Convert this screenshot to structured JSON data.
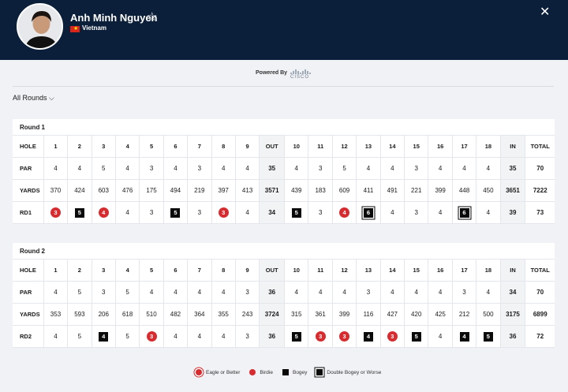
{
  "header": {
    "player_name": "Anh Minh Nguyen",
    "country": "Vietnam",
    "favorite_icon": "star-outline-icon",
    "close_icon": "close-icon",
    "colors": {
      "background": "#0b1f3a",
      "flag": "#da251d",
      "flag_star": "#ffde00"
    }
  },
  "sponsor": {
    "label": "Powered By",
    "brand": "CISCO"
  },
  "rounds_dropdown": {
    "label": "All Rounds"
  },
  "score_colors": {
    "under_par": "#d62b2f",
    "over_par": "#0a0a0a"
  },
  "rounds": [
    {
      "title": "Round 1",
      "head": [
        "HOLE",
        "1",
        "2",
        "3",
        "4",
        "5",
        "6",
        "7",
        "8",
        "9",
        "OUT",
        "10",
        "11",
        "12",
        "13",
        "14",
        "15",
        "16",
        "17",
        "18",
        "IN",
        "TOTAL"
      ],
      "par": [
        "PAR",
        "4",
        "4",
        "5",
        "4",
        "3",
        "4",
        "3",
        "4",
        "4",
        "35",
        "4",
        "3",
        "5",
        "4",
        "4",
        "3",
        "4",
        "4",
        "4",
        "35",
        "70"
      ],
      "yards": [
        "YARDS",
        "370",
        "424",
        "603",
        "476",
        "175",
        "494",
        "219",
        "397",
        "413",
        "3571",
        "439",
        "183",
        "609",
        "411",
        "491",
        "221",
        "399",
        "448",
        "450",
        "3651",
        "7222"
      ],
      "score_label": "RD1",
      "scores": [
        {
          "v": "3",
          "t": "birdie"
        },
        {
          "v": "5",
          "t": "bogey"
        },
        {
          "v": "4",
          "t": "birdie"
        },
        {
          "v": "4",
          "t": "par"
        },
        {
          "v": "3",
          "t": "par"
        },
        {
          "v": "5",
          "t": "bogey"
        },
        {
          "v": "3",
          "t": "par"
        },
        {
          "v": "3",
          "t": "birdie"
        },
        {
          "v": "4",
          "t": "par"
        },
        {
          "v": "34",
          "t": "out"
        },
        {
          "v": "5",
          "t": "bogey"
        },
        {
          "v": "3",
          "t": "par"
        },
        {
          "v": "4",
          "t": "birdie"
        },
        {
          "v": "6",
          "t": "double"
        },
        {
          "v": "4",
          "t": "par"
        },
        {
          "v": "3",
          "t": "par"
        },
        {
          "v": "4",
          "t": "par"
        },
        {
          "v": "6",
          "t": "double"
        },
        {
          "v": "4",
          "t": "par"
        },
        {
          "v": "39",
          "t": "in"
        },
        {
          "v": "73",
          "t": "total"
        }
      ]
    },
    {
      "title": "Round 2",
      "head": [
        "HOLE",
        "1",
        "2",
        "3",
        "4",
        "5",
        "6",
        "7",
        "8",
        "9",
        "OUT",
        "10",
        "11",
        "12",
        "13",
        "14",
        "15",
        "16",
        "17",
        "18",
        "IN",
        "TOTAL"
      ],
      "par": [
        "PAR",
        "4",
        "5",
        "3",
        "5",
        "4",
        "4",
        "4",
        "4",
        "3",
        "36",
        "4",
        "4",
        "4",
        "3",
        "4",
        "4",
        "4",
        "3",
        "4",
        "34",
        "70"
      ],
      "yards": [
        "YARDS",
        "353",
        "593",
        "206",
        "618",
        "510",
        "482",
        "364",
        "355",
        "243",
        "3724",
        "315",
        "361",
        "399",
        "116",
        "427",
        "420",
        "425",
        "212",
        "500",
        "3175",
        "6899"
      ],
      "score_label": "RD2",
      "scores": [
        {
          "v": "4",
          "t": "par"
        },
        {
          "v": "5",
          "t": "par"
        },
        {
          "v": "4",
          "t": "bogey"
        },
        {
          "v": "5",
          "t": "par"
        },
        {
          "v": "3",
          "t": "birdie"
        },
        {
          "v": "4",
          "t": "par"
        },
        {
          "v": "4",
          "t": "par"
        },
        {
          "v": "4",
          "t": "par"
        },
        {
          "v": "3",
          "t": "par"
        },
        {
          "v": "36",
          "t": "out"
        },
        {
          "v": "5",
          "t": "bogey"
        },
        {
          "v": "3",
          "t": "birdie"
        },
        {
          "v": "3",
          "t": "birdie"
        },
        {
          "v": "4",
          "t": "bogey"
        },
        {
          "v": "3",
          "t": "birdie"
        },
        {
          "v": "5",
          "t": "bogey"
        },
        {
          "v": "4",
          "t": "par"
        },
        {
          "v": "4",
          "t": "bogey"
        },
        {
          "v": "5",
          "t": "bogey"
        },
        {
          "v": "36",
          "t": "in"
        },
        {
          "v": "72",
          "t": "total"
        }
      ]
    }
  ],
  "legend": [
    {
      "label": "Eagle or Better",
      "type": "eagle"
    },
    {
      "label": "Birdie",
      "type": "birdie"
    },
    {
      "label": "Bogey",
      "type": "bogey"
    },
    {
      "label": "Double Bogey or Worse",
      "type": "double"
    }
  ]
}
